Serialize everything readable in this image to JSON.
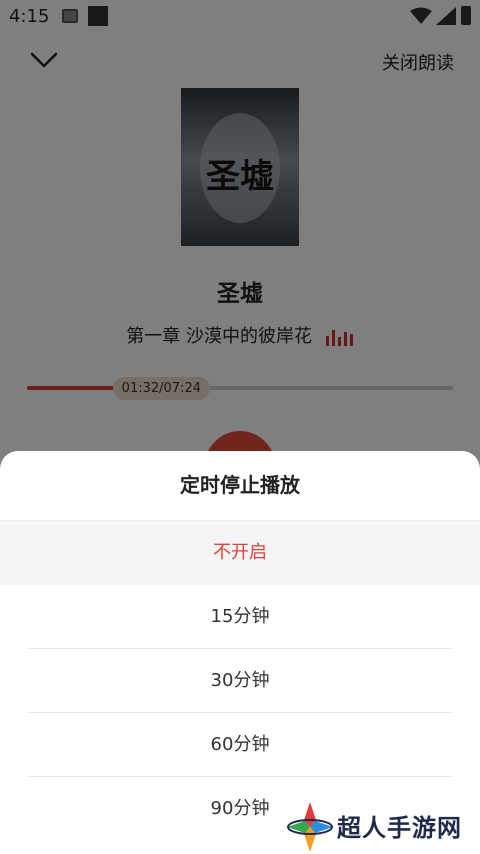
{
  "status_bar": {
    "time": "4:15"
  },
  "player": {
    "close_label": "关闭朗读",
    "book_title": "圣墟",
    "cover_text": "圣墟",
    "chapter": "第一章 沙漠中的彼岸花",
    "progress_time": "01:32/07:24",
    "progress_fraction": 0.207
  },
  "timer_sheet": {
    "title": "定时停止播放",
    "options": [
      {
        "label": "不开启",
        "selected": true
      },
      {
        "label": "15分钟",
        "selected": false
      },
      {
        "label": "30分钟",
        "selected": false
      },
      {
        "label": "60分钟",
        "selected": false
      },
      {
        "label": "90分钟",
        "selected": false
      }
    ]
  },
  "watermark": {
    "text": "超人手游网"
  },
  "colors": {
    "accent": "#e0423a",
    "progress_bg": "#f0dcd0"
  }
}
